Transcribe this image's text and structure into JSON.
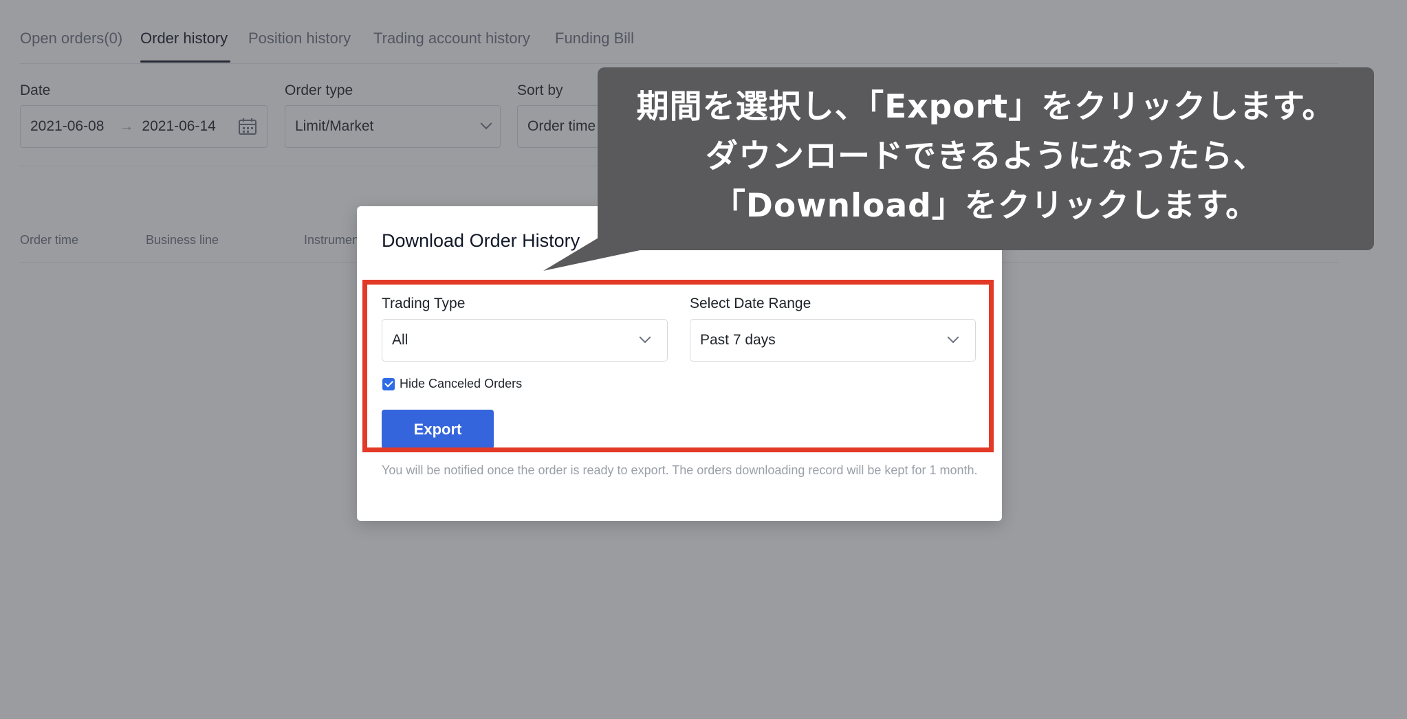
{
  "tabs": [
    {
      "label": "Open orders(0)",
      "active": false
    },
    {
      "label": "Order history",
      "active": true
    },
    {
      "label": "Position history",
      "active": false
    },
    {
      "label": "Trading account history",
      "active": false
    },
    {
      "label": "Funding Bill",
      "active": false
    }
  ],
  "filters": {
    "date": {
      "label": "Date",
      "start": "2021-06-08",
      "end": "2021-06-14"
    },
    "order_type": {
      "label": "Order type",
      "value": "Limit/Market"
    },
    "sort_by": {
      "label": "Sort by",
      "value": "Order time"
    }
  },
  "table": {
    "headers": [
      "Order time",
      "Business line",
      "Instrument"
    ]
  },
  "modal": {
    "title": "Download Order History",
    "trading_type": {
      "label": "Trading Type",
      "value": "All"
    },
    "date_range": {
      "label": "Select Date Range",
      "value": "Past 7 days"
    },
    "hide_canceled": {
      "label": "Hide Canceled Orders",
      "checked": true
    },
    "export_label": "Export",
    "note": "You will be notified once the order is ready to export. The orders downloading record will be kept for 1 month."
  },
  "callout": {
    "lines": [
      "期間を選択し、「Export」をクリックします。",
      "ダウンロードできるようになったら、",
      "「Download」をクリックします。"
    ]
  },
  "colors": {
    "accent_blue": "#3565dc",
    "highlight_red": "#e23a27",
    "callout_bg": "#5a5a5c"
  }
}
